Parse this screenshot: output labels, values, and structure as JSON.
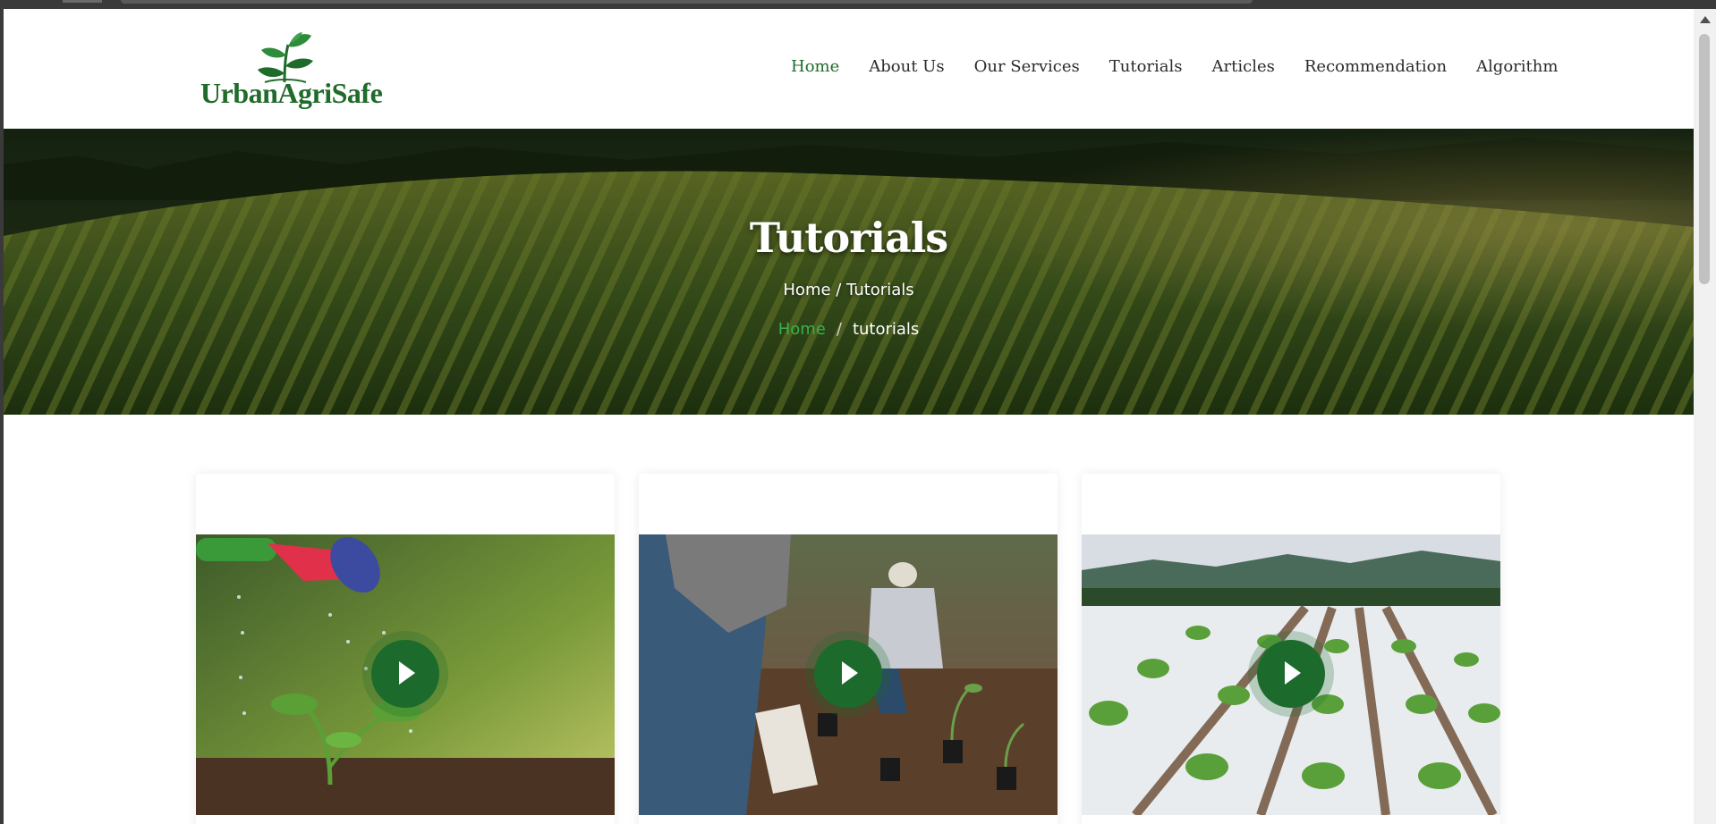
{
  "brand": {
    "name": "UrbanAgriSafe"
  },
  "nav": {
    "items": [
      "Home",
      "About Us",
      "Our Services",
      "Tutorials",
      "Articles",
      "Recommendation",
      "Algorithm"
    ],
    "active": "Home"
  },
  "hero": {
    "title": "Tutorials",
    "subtitle": "Home / Tutorials",
    "breadcrumb": {
      "home": "Home",
      "separator": "/",
      "current": "tutorials"
    }
  },
  "tutorials": {
    "cards": [
      {
        "image": "watering-seedling",
        "icon": "play-icon"
      },
      {
        "image": "people-planting",
        "icon": "play-icon"
      },
      {
        "image": "lettuce-field",
        "icon": "play-icon"
      }
    ]
  },
  "colors": {
    "brand_green": "#1f6b2a",
    "play_button": "#1c6b2d",
    "crumb_home": "#35b24a"
  }
}
